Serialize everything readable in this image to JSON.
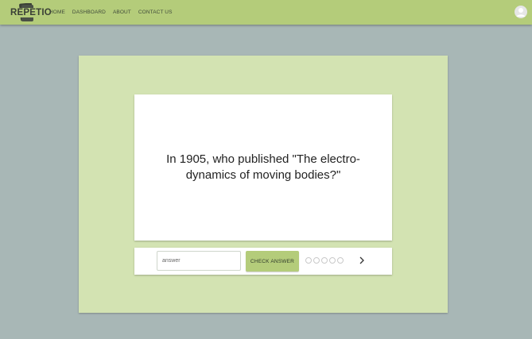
{
  "app": {
    "name": "REPETIO"
  },
  "nav": {
    "items": [
      {
        "label": "HOME"
      },
      {
        "label": "DASHBOARD"
      },
      {
        "label": "ABOUT"
      },
      {
        "label": "CONTACT US"
      }
    ]
  },
  "user": {
    "avatar_icon": "account-circle-icon"
  },
  "quiz": {
    "question": "In 1905, who published \"The electro-dynamics of moving bodies?\"",
    "answer_placeholder": "answer",
    "answer_value": "",
    "check_label": "CHECK ANSWER",
    "progress": {
      "total": 5,
      "completed": 0
    },
    "next_icon": "chevron-right-icon"
  },
  "colors": {
    "accent": "#b4cc7a",
    "background": "#a8b7b6",
    "card_background": "#d3e3b2",
    "text": "#222222"
  }
}
